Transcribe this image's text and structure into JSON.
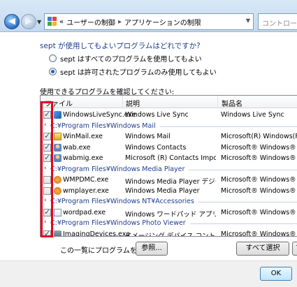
{
  "nav": {
    "breadcrumb_prefix": "«",
    "breadcrumb_1": "ユーザーの制御",
    "breadcrumb_2": "アプリケーションの制限",
    "chevron": "▸",
    "search_placeholder": "コントロール"
  },
  "question": "sept が使用してもよいプログラムはどれですか?",
  "radios": [
    {
      "label": "sept はすべてのプログラムを使用してもよい",
      "checked": false
    },
    {
      "label": "sept は許可されたプログラムのみ使用してもよい",
      "checked": true
    }
  ],
  "list_caption": "使用できるプログラムを確認してください:",
  "columns": {
    "file": "ファイル",
    "description": "説明",
    "product": "製品名"
  },
  "rows": [
    {
      "kind": "item",
      "checked": true,
      "icon": "app-icon",
      "name": "WindowsLiveSync.exe",
      "desc": "Windows Live Sync",
      "prod": "Windows Live Sync"
    },
    {
      "kind": "group",
      "label": "C:¥Program Files¥Windows Mail"
    },
    {
      "kind": "item",
      "checked": true,
      "icon": "mail-icon",
      "name": "WinMail.exe",
      "desc": "Windows Mail",
      "prod": "Microsoft(R) Windows(R) Ope"
    },
    {
      "kind": "item",
      "checked": true,
      "icon": "contacts-icon",
      "name": "wab.exe",
      "desc": "Windows Contacts",
      "prod": "Microsoft® Windows® Opera"
    },
    {
      "kind": "item",
      "checked": true,
      "icon": "contacts-icon",
      "name": "wabmig.exe",
      "desc": "Microsoft (R) Contacts Import Tool",
      "prod": "Microsoft® Windows® Opera"
    },
    {
      "kind": "group",
      "label": "C:¥Program Files¥Windows Media Player"
    },
    {
      "kind": "item",
      "checked": false,
      "icon": "media-icon",
      "name": "WMPDMC.exe",
      "desc": "Windows Media Player デジタル...",
      "prod": "Microsoft® Windows® Opera"
    },
    {
      "kind": "item",
      "checked": false,
      "icon": "media-icon",
      "name": "wmplayer.exe",
      "desc": "Windows Media Player",
      "prod": "Microsoft® Windows® Opera"
    },
    {
      "kind": "group",
      "label": "C:¥Program Files¥Windows NT¥Accessories"
    },
    {
      "kind": "item",
      "checked": true,
      "icon": "document-icon",
      "name": "wordpad.exe",
      "desc": "Windows ワードパッド アプリケ...",
      "prod": "Microsoft® Windows® Opera"
    },
    {
      "kind": "group",
      "label": "C:¥Program Files¥Windows Photo Viewer"
    },
    {
      "kind": "item",
      "checked": true,
      "icon": "camera-icon",
      "name": "ImagingDevices.exe",
      "desc": "イメージング デバイス コントロ...",
      "prod": "Microsoft® Windows® Opera"
    }
  ],
  "add_label": "この一覧にプログラムを追加:",
  "browse_button": "参照...",
  "select_all_button": "すべて選択",
  "clear_button": "す",
  "ok_button": "OK",
  "highlight_color": "#e8001d"
}
